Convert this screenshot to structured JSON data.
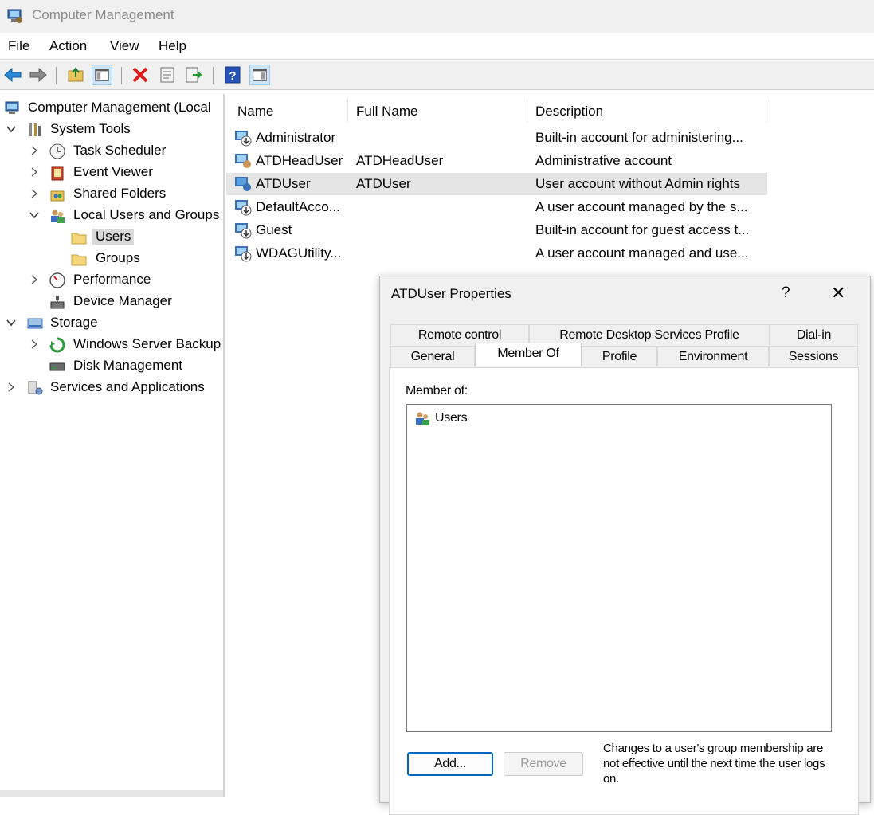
{
  "window": {
    "title": "Computer Management"
  },
  "menu": [
    "File",
    "Action",
    "View",
    "Help"
  ],
  "tree": {
    "root": "Computer Management (Local",
    "system_tools": "System Tools",
    "task_scheduler": "Task Scheduler",
    "event_viewer": "Event Viewer",
    "shared_folders": "Shared Folders",
    "local_users_groups": "Local Users and Groups",
    "users": "Users",
    "groups": "Groups",
    "performance": "Performance",
    "device_manager": "Device Manager",
    "storage": "Storage",
    "windows_server_backup": "Windows Server Backup",
    "disk_management": "Disk Management",
    "services_apps": "Services and Applications"
  },
  "list": {
    "columns": [
      "Name",
      "Full Name",
      "Description"
    ],
    "rows": [
      {
        "name": "Administrator",
        "full_name": "",
        "description": "Built-in account for administering..."
      },
      {
        "name": "ATDHeadUser",
        "full_name": "ATDHeadUser",
        "description": "Administrative account"
      },
      {
        "name": "ATDUser",
        "full_name": "ATDUser",
        "description": "User account without Admin rights"
      },
      {
        "name": "DefaultAcco...",
        "full_name": "",
        "description": "A user account managed by the s..."
      },
      {
        "name": "Guest",
        "full_name": "",
        "description": "Built-in account for guest access t..."
      },
      {
        "name": "WDAGUtility...",
        "full_name": "",
        "description": "A user account managed and use..."
      }
    ]
  },
  "dialog": {
    "title": "ATDUser Properties",
    "help": "?",
    "close": "✕",
    "tabs_row1": [
      "Remote control",
      "Remote Desktop Services Profile",
      "Dial-in"
    ],
    "tabs_row2": [
      "General",
      "Member Of",
      "Profile",
      "Environment",
      "Sessions"
    ],
    "active_tab": "Member Of",
    "member_of_label": "Member of:",
    "members": [
      "Users"
    ],
    "add_button": "Add...",
    "remove_button": "Remove",
    "note": "Changes to a user's group membership are not effective until the next time the user logs on."
  }
}
